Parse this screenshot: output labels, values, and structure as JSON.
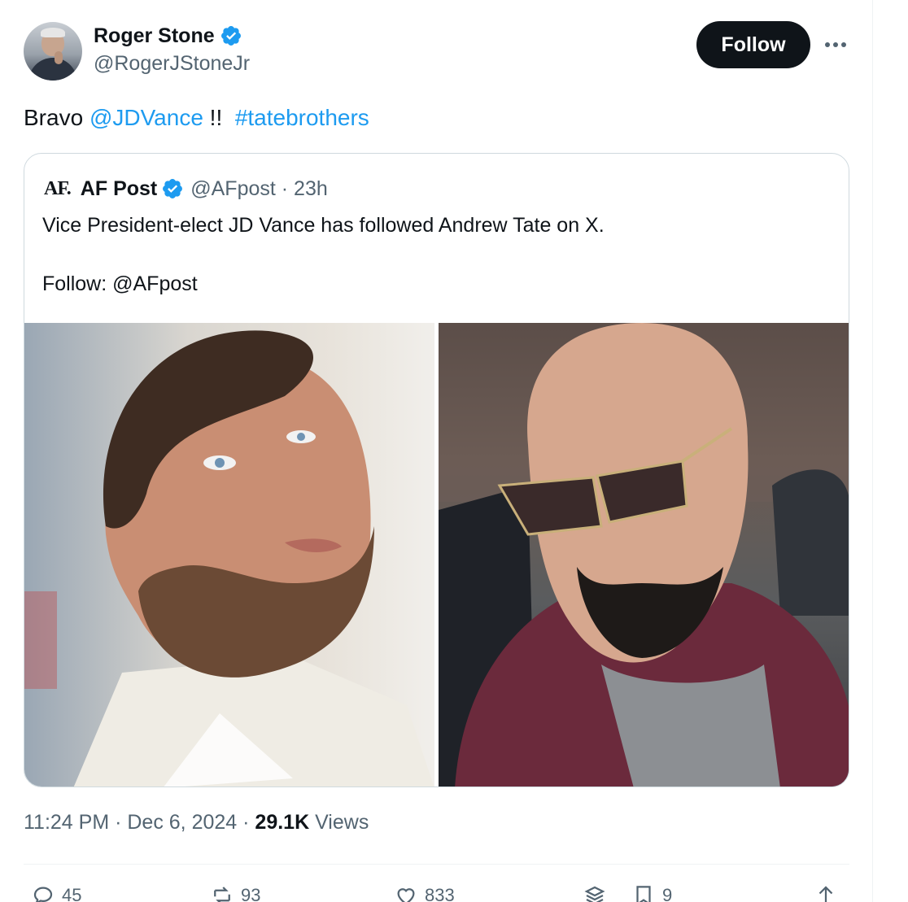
{
  "author": {
    "display_name": "Roger Stone",
    "handle": "@RogerJStoneJr",
    "verified": true
  },
  "header": {
    "follow_label": "Follow",
    "more_icon": "more-horizontal-icon"
  },
  "tweet": {
    "text_before": "Bravo ",
    "mention": "@JDVance",
    "text_middle": " !!  ",
    "hashtag": "#tatebrothers"
  },
  "quote": {
    "logo": "AF.",
    "name": "AF Post",
    "handle": "@AFpost",
    "time": "23h",
    "separator": " · ",
    "text_line1": "Vice President-elect JD Vance has followed Andrew Tate on X.",
    "text_line2": "Follow: @AFpost",
    "images": [
      "photo-jd-vance",
      "photo-andrew-tate"
    ]
  },
  "meta": {
    "time": "11:24 PM",
    "sep": " · ",
    "date": "Dec 6, 2024",
    "views_count": "29.1K",
    "views_label": " Views"
  },
  "actions": {
    "replies": "45",
    "reposts": "93",
    "likes": "833",
    "bookmarks": "9"
  },
  "colors": {
    "accent": "#1d9bf0",
    "text": "#0f1419",
    "secondary": "#536471",
    "border": "#cfd9de"
  }
}
